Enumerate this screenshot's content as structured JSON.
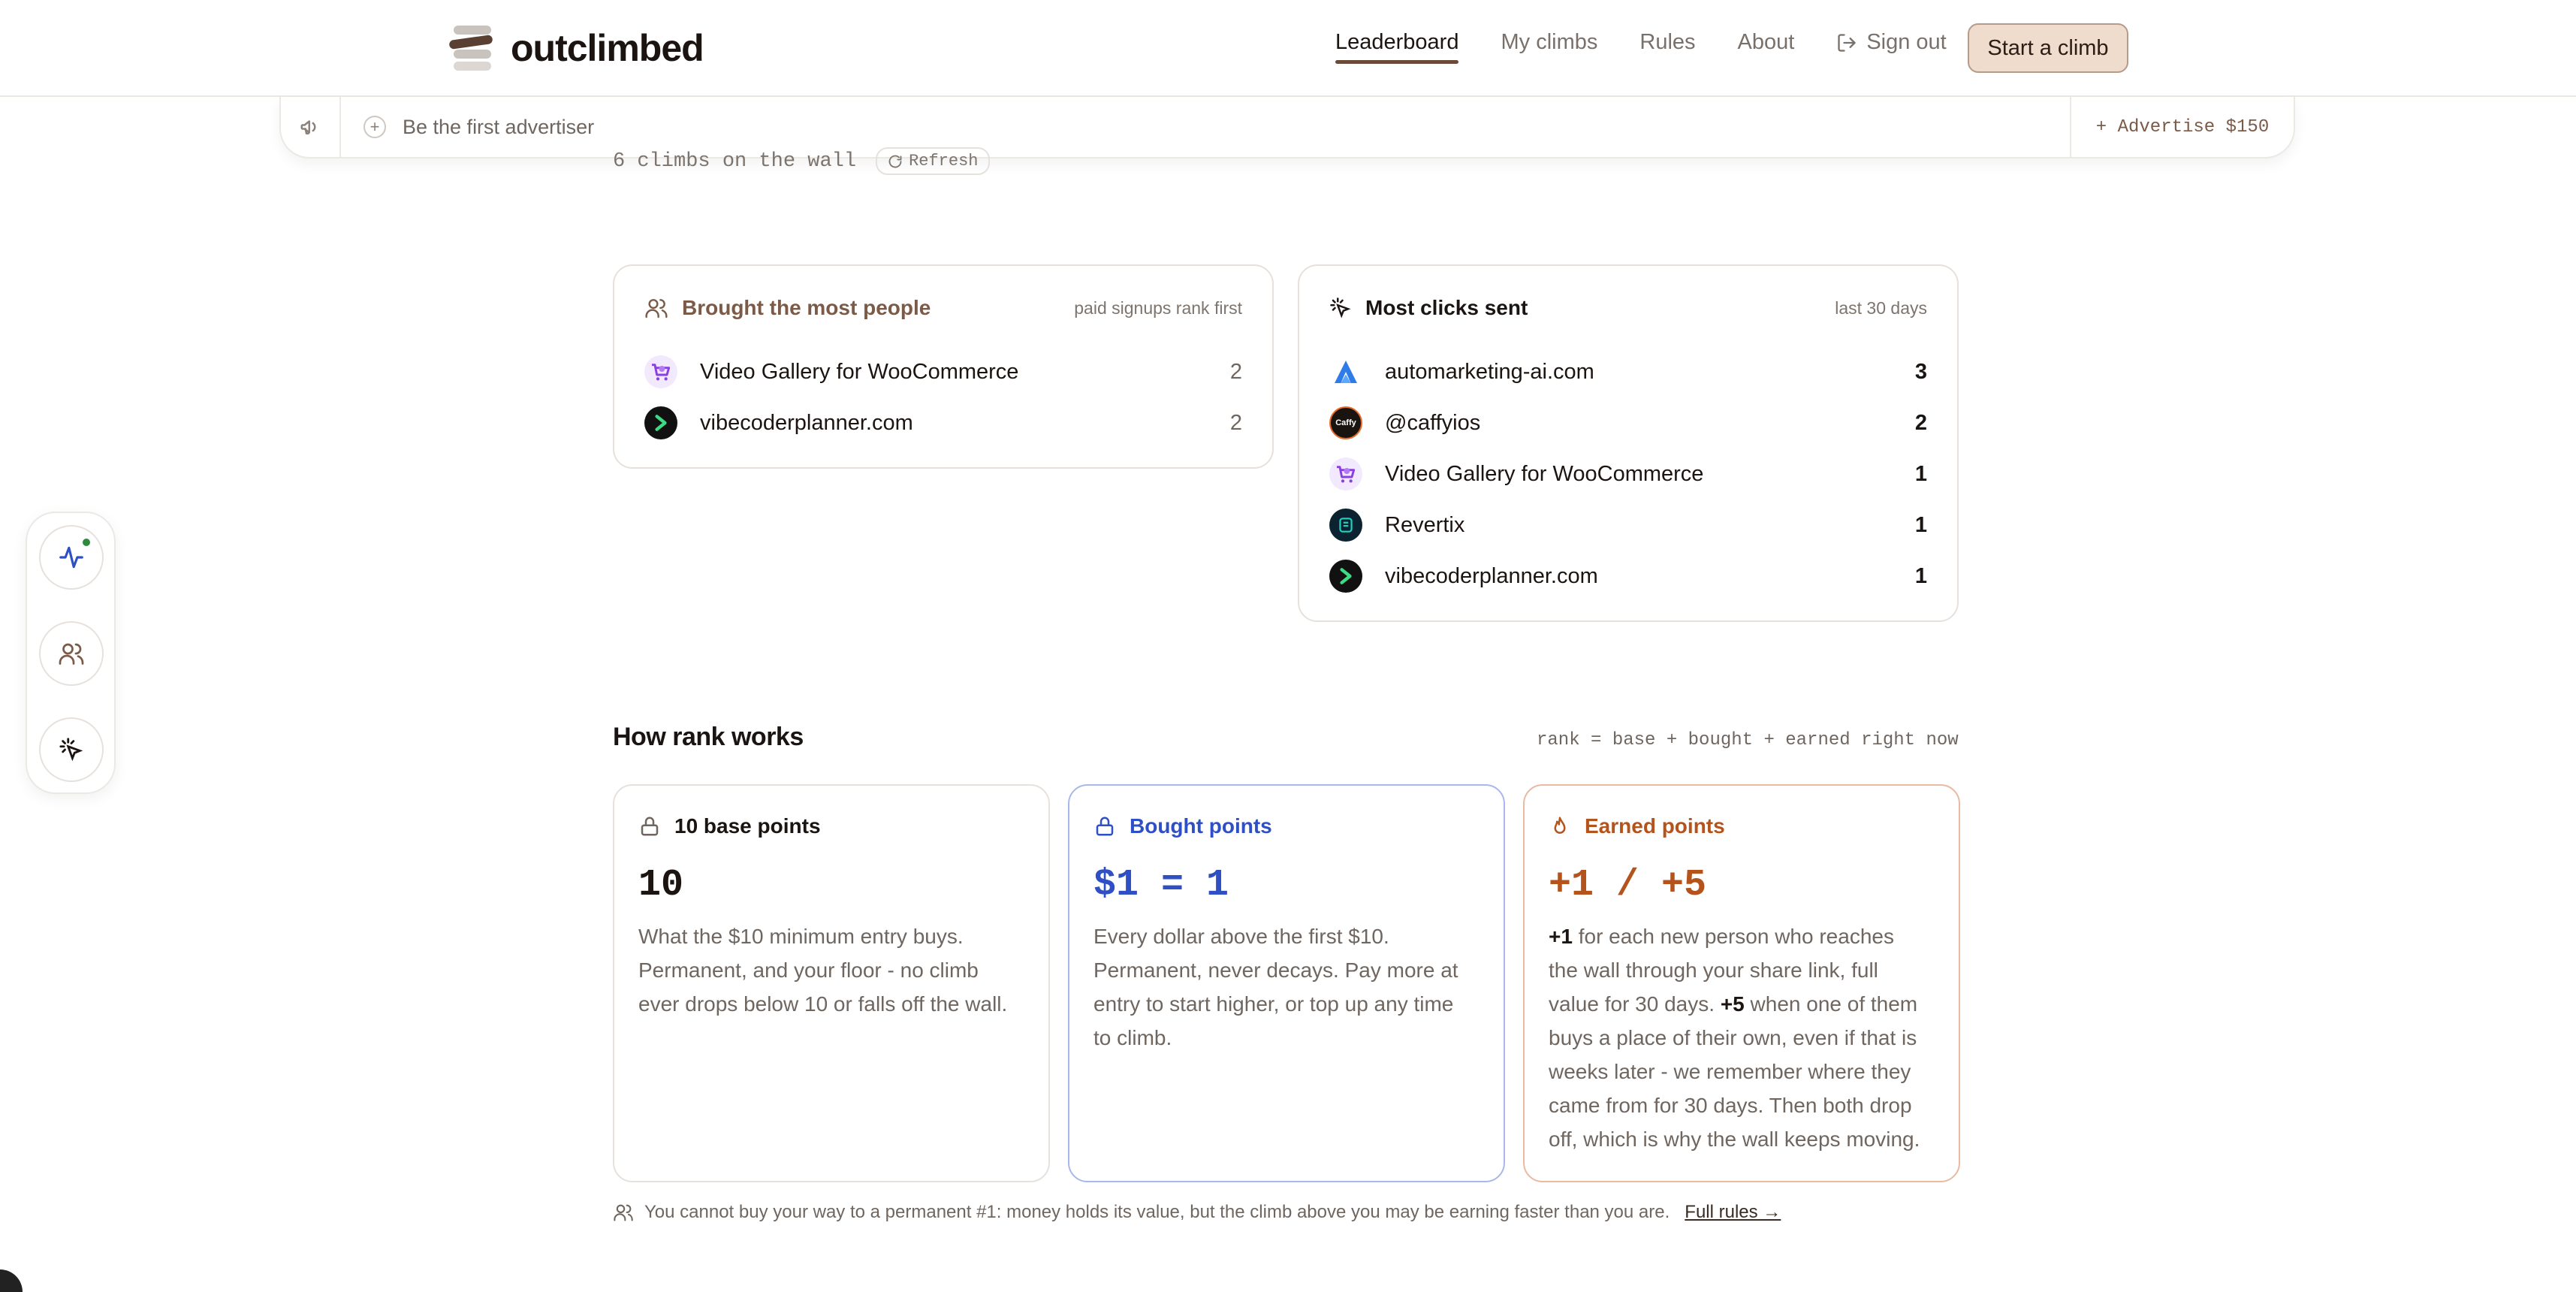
{
  "brand": {
    "name": "outclimbed"
  },
  "nav": {
    "items": [
      {
        "label": "Leaderboard",
        "active": true
      },
      {
        "label": "My climbs",
        "active": false
      },
      {
        "label": "Rules",
        "active": false
      },
      {
        "label": "About",
        "active": false
      }
    ],
    "signout": "Sign out",
    "cta": "Start a climb"
  },
  "adbar": {
    "placeholder": "Be the first advertiser",
    "advertise": "+ Advertise $150"
  },
  "wall": {
    "count_text": "6 climbs on the wall",
    "refresh": "Refresh"
  },
  "people_card": {
    "title": "Brought the most people",
    "note": "paid signups rank first",
    "rows": [
      {
        "name": "Video Gallery for WooCommerce",
        "count": "2",
        "icon": "woo-gallery-logo"
      },
      {
        "name": "vibecoderplanner.com",
        "count": "2",
        "icon": "vibecoder-logo"
      }
    ]
  },
  "clicks_card": {
    "title": "Most clicks sent",
    "note": "last 30 days",
    "rows": [
      {
        "name": "automarketing-ai.com",
        "count": "3",
        "icon": "automarketing-logo"
      },
      {
        "name": "@caffyios",
        "count": "2",
        "icon": "caffy-logo",
        "badge": "Caffy"
      },
      {
        "name": "Video Gallery for WooCommerce",
        "count": "1",
        "icon": "woo-gallery-logo"
      },
      {
        "name": "Revertix",
        "count": "1",
        "icon": "revertix-logo"
      },
      {
        "name": "vibecoderplanner.com",
        "count": "1",
        "icon": "vibecoder-logo"
      }
    ]
  },
  "how": {
    "title": "How rank works",
    "formula": "rank = base + bought + earned right now",
    "cards": [
      {
        "title": "10 base points",
        "big": "10",
        "body": "What the $10 minimum entry buys. Permanent, and your floor - no climb ever drops below 10 or falls off the wall.",
        "color": "#1c1410"
      },
      {
        "title": "Bought points",
        "big": "$1 = 1",
        "body": "Every dollar above the first $10. Permanent, never decays. Pay more at entry to start higher, or top up any time to climb.",
        "color": "#2f4fc4"
      },
      {
        "title": "Earned points",
        "big": "+1 / +5",
        "body_b1": "+1",
        "body_1": " for each new person who reaches the wall through your share link, full value for 30 days. ",
        "body_b2": "+5",
        "body_2": " when one of them buys a place of their own, even if that is weeks later - we remember where they came from for 30 days. Then both drop off, which is why the wall keeps moving.",
        "color": "#b4531c"
      }
    ],
    "footnote": "You cannot buy your way to a permanent #1: money holds its value, but the climb above you may be earning faster than you are.",
    "rules_link": "Full rules →"
  },
  "colors": {
    "accent": "#6b4a3a",
    "cta_bg": "#f0dccd",
    "blue": "#2f4fc4",
    "orange": "#b4531c",
    "status_dot": "#2e8a3c"
  }
}
